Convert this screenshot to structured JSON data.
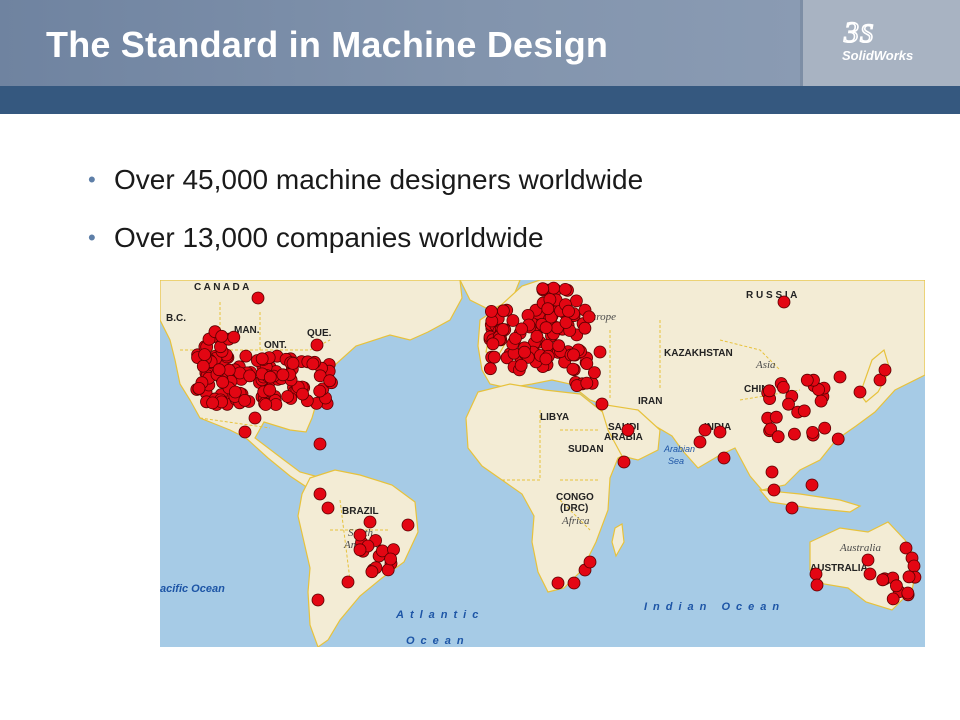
{
  "slide": {
    "title": "The Standard in Machine Design",
    "logo_text": "SolidWorks",
    "bullets": [
      "Over 45,000 machine designers worldwide",
      "Over 13,000 companies worldwide"
    ]
  },
  "map": {
    "country_labels": {
      "canada": "C A N A D A",
      "bc": "B.C.",
      "man": "MAN.",
      "ont": "ONT.",
      "que": "QUE.",
      "russia": "R U S S I A",
      "kazakhstan": "KAZAKHSTAN",
      "china": "CHINA",
      "iran": "IRAN",
      "libya": "LIBYA",
      "sudan": "SUDAN",
      "saudi": "SAUDI",
      "arabia": "ARABIA",
      "india": "INDIA",
      "congo": "CONGO",
      "drc": "(DRC)",
      "brazil": "BRAZIL",
      "australia": "AUSTRALIA"
    },
    "continent_labels": {
      "europe": "Europe",
      "asia": "Asia",
      "africa": "Africa",
      "south_america_1": "South",
      "south_america_2": "America",
      "australia": "Australia"
    },
    "water_labels": {
      "pacific": "acific Ocean",
      "atlantic_1": "Atlantic",
      "atlantic_2": "Ocean",
      "indian": "Indian Ocean",
      "arabian_1": "Arabian",
      "arabian_2": "Sea"
    },
    "colors": {
      "water": "#a6cbe6",
      "land": "#f3ecd5",
      "border": "#e7c23c",
      "marker": "#e30613"
    }
  }
}
